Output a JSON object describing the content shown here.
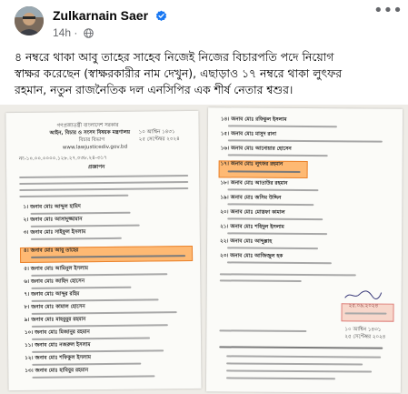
{
  "post": {
    "author": "Zulkarnain Saer",
    "time": "14h",
    "text_lines": [
      "৪ নম্বরে থাকা আবু তাহের সাহেব নিজেই নিজের বিচারপতি পদে নিয়োগ",
      "স্বাক্ষর করেছেন (স্বাক্ষরকারীর নাম দেখুন), এছাড়াও ১৭ নম্বরে থাকা লুৎফর",
      "রহমান, নতুন রাজনৈতিক দল এনসিপির এক শীর্ষ নেতার শ্বশুর।"
    ]
  },
  "icons": {
    "verified": "verified-badge-icon",
    "audience": "globe-icon",
    "more": "more-options-icon"
  },
  "document": {
    "left": {
      "header_lines": [
        "গণপ্রজাতন্ত্রী বাংলাদেশ সরকার",
        "আইন, বিচার ও সংসদ বিষয়ক মন্ত্রণালয়",
        "বিচার বিভাগ",
        "www.lawjusticediv.gov.bd"
      ],
      "date_lines": [
        "১০ আশ্বিন ১৪৩১",
        "২৫ সেপ্টেম্বর ২০২৪"
      ],
      "ref_line": "নং-১০.০০.০০০০.১২৮.২৭.০৩৮.২৪-৩১৭",
      "notice_title": "প্রজ্ঞাপন",
      "names": [
        "১। জনাব মোঃ আব্দুল হামিদ",
        "২। জনাব মোঃ আসাদুজ্জামান",
        "৩। জনাব মোঃ সাইফুল ইসলাম",
        "৪। জনাব মোঃ আবু তাহের",
        "৫। জনাব মোঃ আমিনুল ইসলাম",
        "৬। জনাব মোঃ জাহিদ হোসেন",
        "৭। জনাব মোঃ আব্দুর রহিম",
        "৮। জনাব মোঃ কামাল হোসেন",
        "৯। জনাব মোঃ মাহবুবুর রহমান",
        "১০। জনাব মোঃ মিজানুর রহমান",
        "১১। জনাব মোঃ নজরুল ইসলাম",
        "১২। জনাব মোঃ শফিকুল ইসলাম",
        "১৩। জনাব মোঃ হাবিবুর রহমান"
      ]
    },
    "right": {
      "names": [
        "১৪। জনাব মোঃ রফিকুল ইসলাম",
        "১৫। জনাব মোঃ মাসুদ রানা",
        "১৬। জনাব মোঃ আনোয়ার হোসেন",
        "১৭। জনাব মোঃ লুৎফর রহমান",
        "১৮। জনাব মোঃ আতাউর রহমান",
        "১৯। জনাব মোঃ জসিম উদ্দিন",
        "২০। জনাব মোঃ মোস্তফা কামাল",
        "২১। জনাব মোঃ শহিদুল ইসলাম",
        "২২। জনাব মোঃ আব্দুল্লাহ",
        "২৩। জনাব মোঃ আজিজুল হক"
      ],
      "signature_date": "২৫.০৯.২০২৪",
      "footer_date_lines": [
        "১০ আশ্বিন ১৪৩১",
        "২৫ সেপ্টেম্বর ২০২৪"
      ]
    }
  },
  "colors": {
    "highlight": "#ffa64d",
    "meta_text": "#65676b",
    "verified_blue": "#1877f2"
  }
}
